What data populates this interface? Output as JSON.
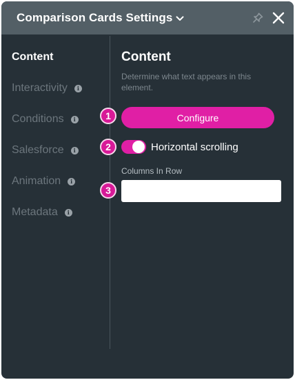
{
  "header": {
    "title": "Comparison Cards Settings",
    "chevron_icon": "chevron-down-icon",
    "pin_icon": "pin-icon",
    "close_icon": "close-icon"
  },
  "nav": {
    "items": [
      {
        "label": "Content",
        "active": true,
        "info": false
      },
      {
        "label": "Interactivity",
        "active": false,
        "info": true
      },
      {
        "label": "Conditions",
        "active": false,
        "info": true
      },
      {
        "label": "Salesforce",
        "active": false,
        "info": true
      },
      {
        "label": "Animation",
        "active": false,
        "info": true
      },
      {
        "label": "Metadata",
        "active": false,
        "info": true
      }
    ],
    "info_glyph": "i"
  },
  "content": {
    "title": "Content",
    "description": "Determine what text appears in this element.",
    "configure_label": "Configure",
    "toggle": {
      "label": "Horizontal scrolling",
      "on": true
    },
    "columns_label": "Columns In Row",
    "columns_value": ""
  },
  "badges": [
    "1",
    "2",
    "3"
  ],
  "colors": {
    "accent": "#e01fa5",
    "panel_bg": "#263037",
    "header_bg": "#535f66"
  }
}
